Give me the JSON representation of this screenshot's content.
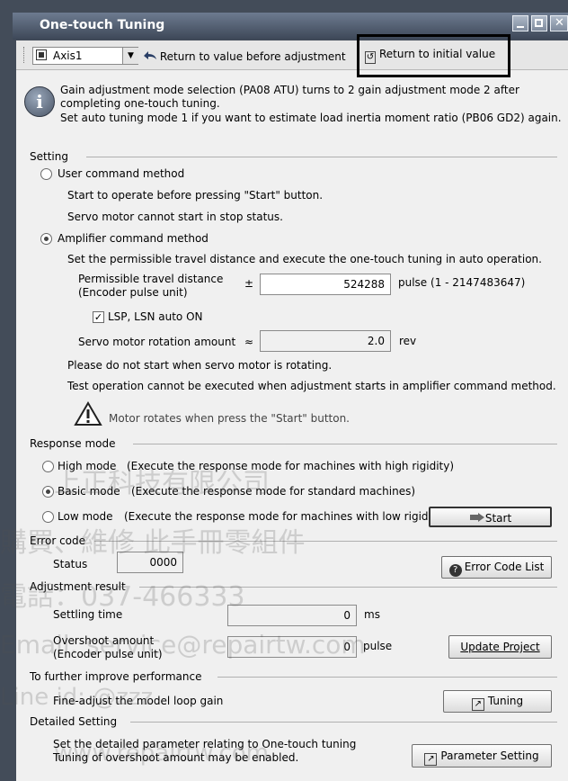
{
  "window": {
    "title": "One-touch Tuning"
  },
  "toolbar": {
    "axis_value": "Axis1",
    "return_before_label": "Return to value before adjustment",
    "return_initial_label": "Return to initial value"
  },
  "info": {
    "line1": "Gain adjustment mode selection (PA08 ATU) turns to 2 gain adjustment mode 2 after",
    "line2": "completing one-touch tuning.",
    "line3": "Set auto tuning mode 1 if you want to estimate load inertia moment ratio (PB06 GD2) again."
  },
  "setting": {
    "group_label": "Setting",
    "user_cmd_label": "User command method",
    "user_cmd_desc1": "Start to operate before pressing \"Start\" button.",
    "user_cmd_desc2": "Servo motor cannot start in stop status.",
    "amp_cmd_label": "Amplifier command method",
    "amp_cmd_desc": "Set the permissible travel distance and execute the one-touch tuning in auto operation.",
    "travel_label1": "Permissible travel distance",
    "travel_label2": "(Encoder pulse unit)",
    "plusminus": "±",
    "travel_value": "524288",
    "travel_unit": "pulse (1 - 2147483647)",
    "lsp_label": "LSP, LSN auto ON",
    "rotation_label": "Servo motor rotation amount",
    "approx": "≈",
    "rotation_value": "2.0",
    "rotation_unit": "rev",
    "warn1": "Please do not start when servo motor is rotating.",
    "warn2": "Test operation cannot be executed when adjustment starts in amplifier command method.",
    "caution_text": "Motor rotates when press the \"Start\" button."
  },
  "response": {
    "group_label": "Response mode",
    "high_label": "High mode",
    "high_desc": "(Execute the response mode for machines with high rigidity)",
    "basic_label": "Basic mode",
    "basic_desc": "(Execute the response mode for standard machines)",
    "low_label": "Low mode",
    "low_desc": "(Execute the response mode for machines with low rigidity)",
    "start_label": "Start"
  },
  "error": {
    "group_label": "Error code",
    "status_label": "Status",
    "status_value": "0000",
    "list_button": "Error Code List"
  },
  "result": {
    "group_label": "Adjustment result",
    "settling_label": "Settling time",
    "settling_value": "0",
    "settling_unit": "ms",
    "overshoot_label1": "Overshoot amount",
    "overshoot_label2": "(Encoder pulse unit)",
    "overshoot_value": "0",
    "overshoot_unit": "pulse",
    "update_button": "Update Project"
  },
  "improve": {
    "group_label": "To further improve performance",
    "desc": "Fine-adjust the model loop gain",
    "tuning_button": "Tuning"
  },
  "detailed": {
    "group_label": "Detailed Setting",
    "desc1": "Set the detailed parameter relating to One-touch tuning",
    "desc2": "Tuning of overshoot amount may be enabled.",
    "param_button": "Parameter Setting"
  },
  "watermark": {
    "line1": "上正科技有限公司",
    "line2": "購買、維修 此手冊零組件",
    "line3": "電話：037-466333",
    "line4": "Email: service@repairtw.com",
    "line5": "Line id: @zzz",
    "line6": "www.repairtw.com"
  },
  "colors": {
    "frame": "#434c59",
    "client": "#f0f0f0",
    "highlight": "#000000"
  }
}
